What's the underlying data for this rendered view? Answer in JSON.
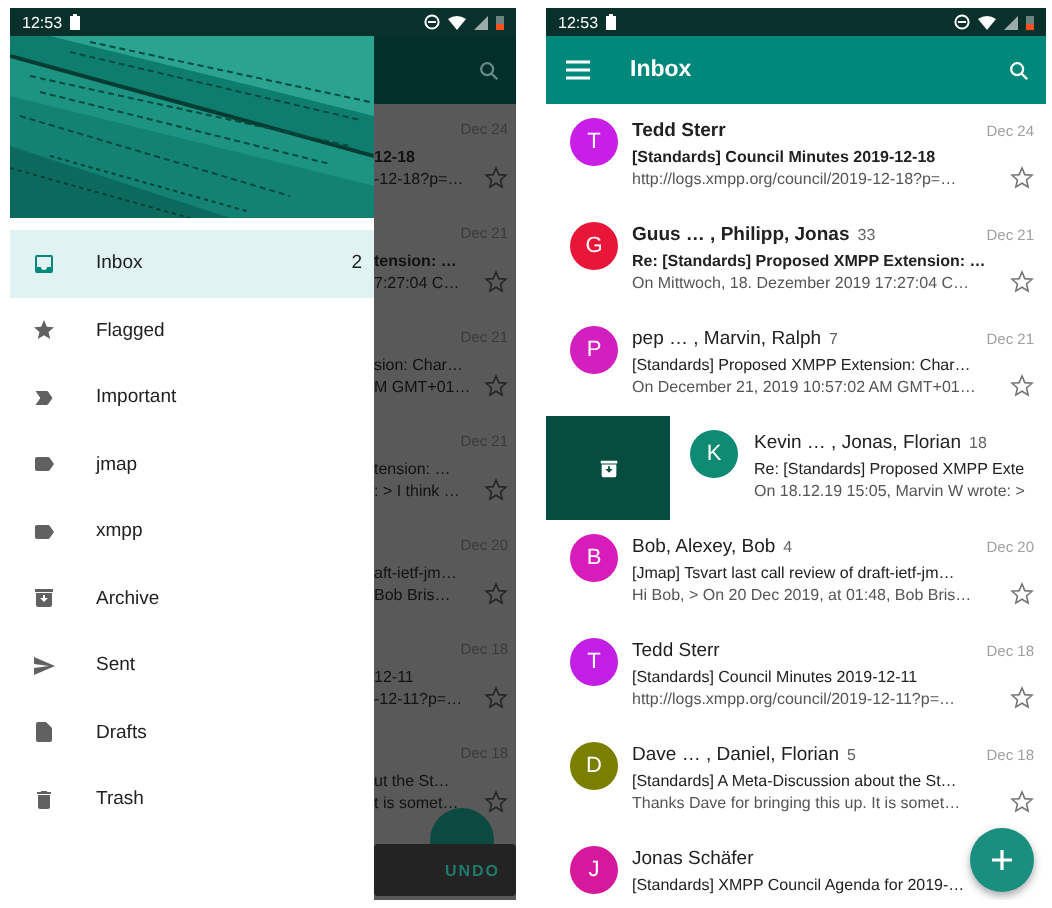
{
  "left_phone": {
    "status_bar": {
      "time": "12:53"
    },
    "drawer": {
      "items": [
        {
          "label": "Inbox",
          "count": "2",
          "selected": true
        },
        {
          "label": "Flagged",
          "selected": false
        },
        {
          "label": "Important",
          "selected": false
        },
        {
          "label": "jmap",
          "selected": false
        },
        {
          "label": "xmpp",
          "selected": false
        },
        {
          "label": "Archive",
          "selected": false
        },
        {
          "label": "Sent",
          "selected": false
        },
        {
          "label": "Drafts",
          "selected": false
        },
        {
          "label": "Trash",
          "selected": false
        }
      ]
    },
    "behind": {
      "rows": [
        {
          "date": "Dec 24",
          "subject": "12-18",
          "preview": "-12-18?p=…",
          "unread": true,
          "starred": false
        },
        {
          "date": "Dec 21",
          "subject": "tension: …",
          "preview": "7:27:04 C…",
          "unread": true,
          "starred": false
        },
        {
          "date": "Dec 21",
          "subject": "sion: Char…",
          "preview": "M GMT+01…",
          "unread": false,
          "starred": false
        },
        {
          "date": "Dec 21",
          "subject": "tension: …",
          "preview": ": > I think …",
          "unread": false,
          "starred": false
        },
        {
          "date": "Dec 20",
          "subject": "aft-ietf-jm…",
          "preview": "Bob Bris…",
          "unread": false,
          "starred": false
        },
        {
          "date": "Dec 18",
          "subject": "12-11",
          "preview": "-12-11?p=…",
          "unread": false,
          "starred": false
        },
        {
          "date": "Dec 18",
          "subject": "ut the St…",
          "preview": "t is somet…",
          "unread": false,
          "starred": false
        }
      ],
      "snackbar": {
        "action": "UNDO"
      }
    }
  },
  "right_phone": {
    "status_bar": {
      "time": "12:53"
    },
    "toolbar": {
      "title": "Inbox"
    },
    "emails": [
      {
        "kind": "normal",
        "avatar": "T",
        "color": "#c81ee8",
        "sender": "Tedd Sterr",
        "date": "Dec 24",
        "subject": "[Standards] Council Minutes 2019-12-18",
        "preview": "http://logs.xmpp.org/council/2019-12-18?p=…",
        "unread": true,
        "starred": false
      },
      {
        "kind": "normal",
        "avatar": "G",
        "color": "#e8173a",
        "sender": "Guus … , Philipp, Jonas",
        "count": "33",
        "date": "Dec 21",
        "subject": "Re: [Standards] Proposed XMPP Extension: …",
        "preview": "On Mittwoch, 18. Dezember 2019 17:27:04 C…",
        "unread": true,
        "starred": false
      },
      {
        "kind": "normal",
        "avatar": "P",
        "color": "#d41fc0",
        "sender": "pep … , Marvin, Ralph",
        "count": "7",
        "date": "Dec 21",
        "subject": "[Standards] Proposed XMPP Extension: Char…",
        "preview": "On December 21, 2019 10:57:02 AM GMT+01…",
        "unread": false,
        "starred": false
      },
      {
        "kind": "swiped",
        "avatar": "K",
        "color": "#0f8a73",
        "sender": "Kevin … , Jonas, Florian",
        "count": "18",
        "subject": "Re: [Standards] Proposed XMPP Exte",
        "preview": "On 18.12.19 15:05, Marvin W wrote: >",
        "unread": false
      },
      {
        "kind": "normal",
        "avatar": "B",
        "color": "#d81bbb",
        "sender": "Bob, Alexey, Bob",
        "count": "4",
        "date": "Dec 20",
        "subject": "[Jmap] Tsvart last call review of draft-ietf-jm…",
        "preview": "Hi Bob, > On 20 Dec 2019, at 01:48, Bob Bris…",
        "unread": false,
        "starred": false
      },
      {
        "kind": "normal",
        "avatar": "T",
        "color": "#c21ee6",
        "sender": "Tedd Sterr",
        "date": "Dec 18",
        "subject": "[Standards] Council Minutes 2019-12-11",
        "preview": "http://logs.xmpp.org/council/2019-12-11?p=…",
        "unread": false,
        "starred": false
      },
      {
        "kind": "normal",
        "avatar": "D",
        "color": "#7b7f00",
        "sender": "Dave … , Daniel, Florian",
        "count": "5",
        "date": "Dec 18",
        "subject": "[Standards] A Meta-Discussion about the St…",
        "preview": "Thanks Dave for bringing this up. It is somet…",
        "unread": false,
        "starred": false
      },
      {
        "kind": "normal",
        "avatar": "J",
        "color": "#d6189c",
        "sender": "Jonas Schäfer",
        "subject": "[Standards] XMPP Council Agenda for 2019-…",
        "unread": false
      }
    ]
  }
}
